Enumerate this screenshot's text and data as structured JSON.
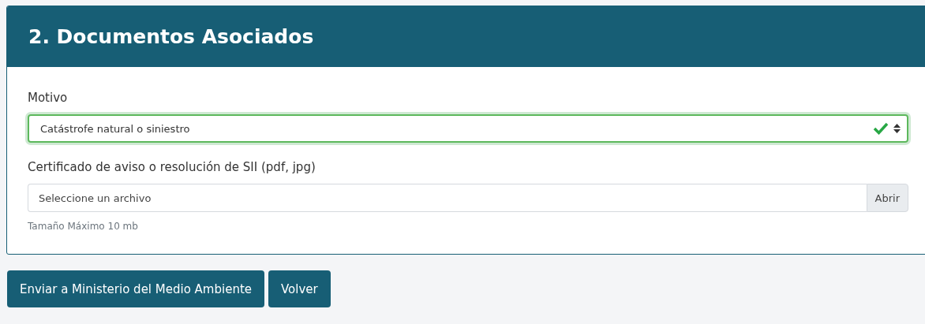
{
  "card": {
    "title": "2. Documentos Asociados"
  },
  "fields": [
    {
      "kind": "select",
      "label": "Motivo",
      "value": "Catástrofe natural o siniestro",
      "valid": true
    },
    {
      "kind": "file",
      "label": "Certificado de aviso o resolución de SII (pdf, jpg)",
      "placeholder": "Seleccione un archivo",
      "button": "Abrir",
      "help": "Tamaño Máximo 10 mb"
    }
  ],
  "buttons": [
    "Enviar a Ministerio del Medio Ambiente",
    "Volver"
  ]
}
